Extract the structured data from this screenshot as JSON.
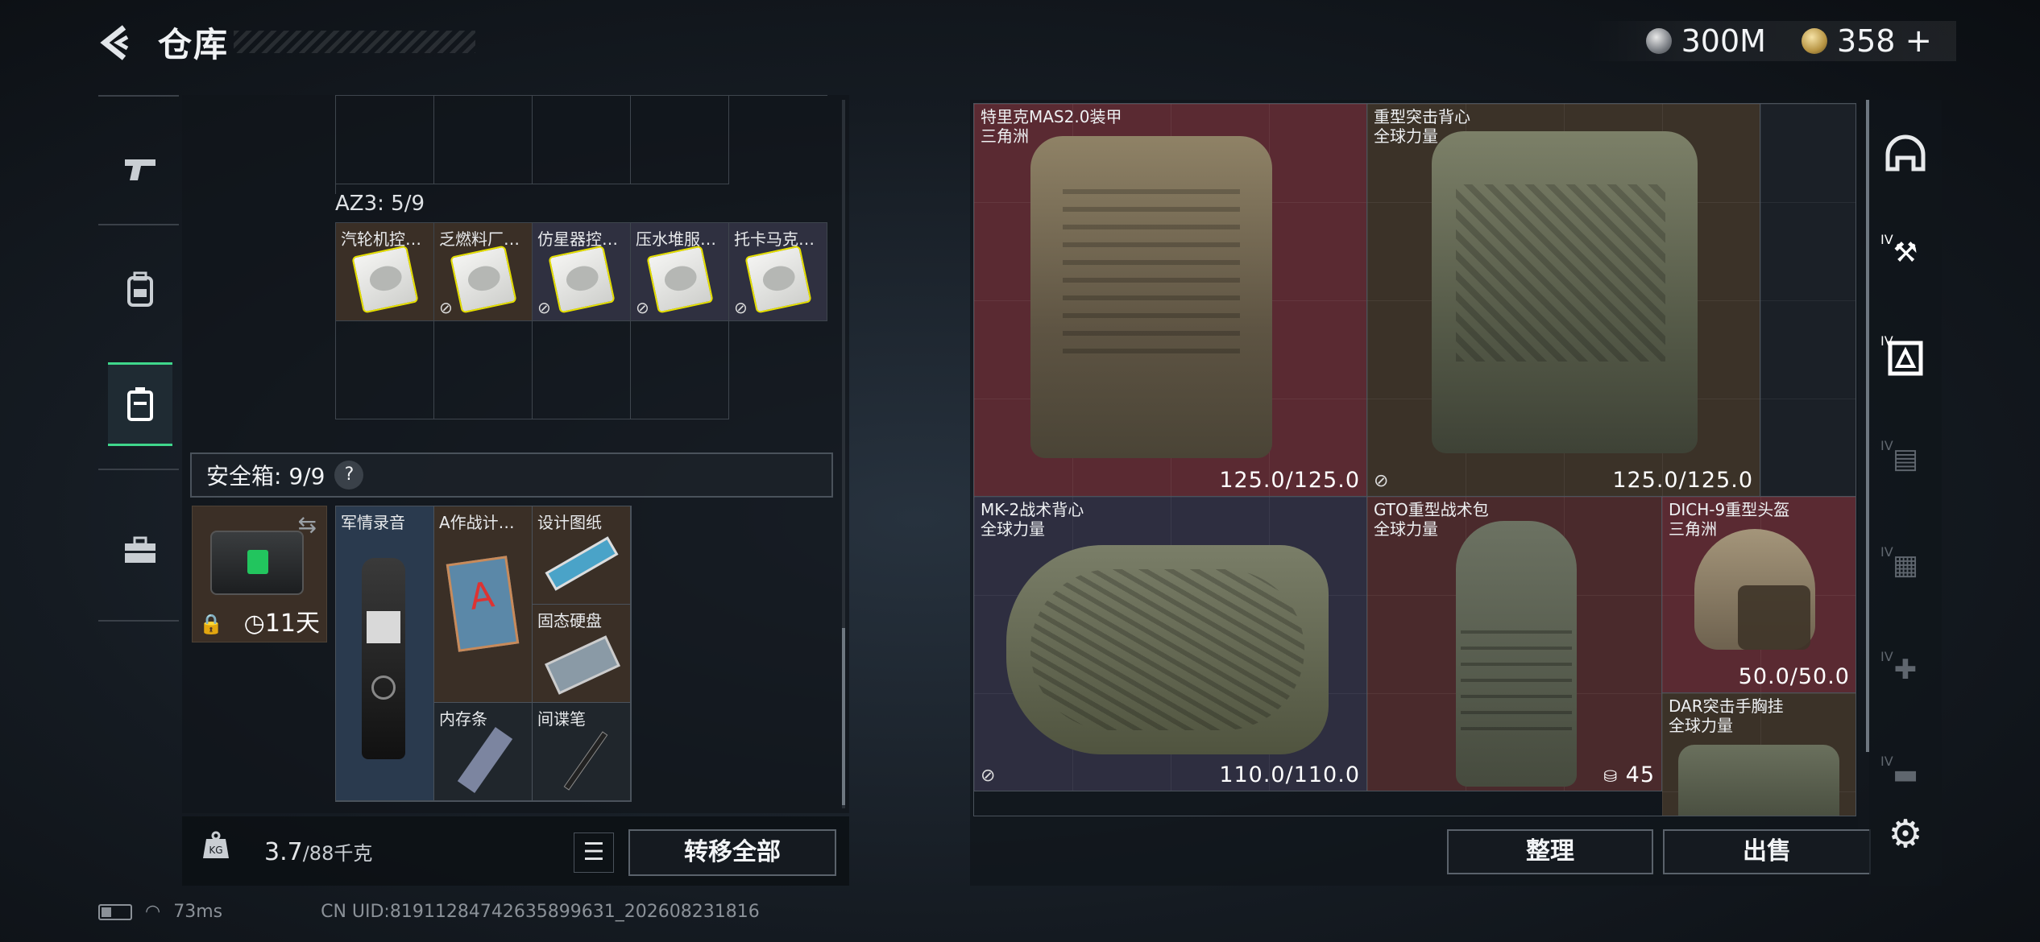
{
  "header": {
    "back_icon": "back-chevron-icon",
    "title": "仓库",
    "currency": [
      {
        "icon": "silver-coin-icon",
        "value": "300M"
      },
      {
        "icon": "gold-coin-icon",
        "value": "358"
      }
    ],
    "plus": "+"
  },
  "left_tabs": [
    {
      "icon": "pistol-icon",
      "active": false
    },
    {
      "icon": "backpack-icon",
      "active": false
    },
    {
      "icon": "vest-container-icon",
      "active": true
    },
    {
      "icon": "toolbox-icon",
      "active": false
    }
  ],
  "az3": {
    "label": "AZ3: 5/9",
    "items": [
      {
        "name": "汽轮机控…",
        "locked": false
      },
      {
        "name": "乏燃料厂…",
        "locked": true
      },
      {
        "name": "仿星器控…",
        "locked": true
      },
      {
        "name": "压水堆服…",
        "locked": true
      },
      {
        "name": "托卡马克…",
        "locked": true
      }
    ]
  },
  "safe_box": {
    "label": "安全箱: 9/9",
    "help": "?",
    "timer": "11天",
    "items": [
      {
        "name": "军情录音"
      },
      {
        "name": "A作战计…"
      },
      {
        "name": "设计图纸"
      },
      {
        "name": "固态硬盘"
      },
      {
        "name": "内存条"
      },
      {
        "name": "间谍笔"
      }
    ]
  },
  "footer": {
    "weight_icon": "KG",
    "weight": "3.7",
    "weight_max": "/88千克",
    "transfer_all": "转移全部"
  },
  "status": {
    "ping": "73ms",
    "uid": "CN UID:81911284742635899631_202608231816"
  },
  "equipment": [
    {
      "name": "特里克MAS2.0装甲",
      "origin": "三角洲",
      "value": "125.0/125.0"
    },
    {
      "name": "重型突击背心",
      "origin": "全球力量",
      "value": "125.0/125.0"
    },
    {
      "name": "MK-2战术背心",
      "origin": "全球力量",
      "value": "110.0/110.0"
    },
    {
      "name": "GTO重型战术包",
      "origin": "全球力量",
      "value": "45"
    },
    {
      "name": "DICH-9重型头盔",
      "origin": "三角洲",
      "value": "50.0/50.0"
    },
    {
      "name": "DAR突击手胸挂",
      "origin": "全球力量",
      "value": ""
    }
  ],
  "actions": {
    "organize": "整理",
    "sell": "出售"
  },
  "right_tabs": [
    {
      "icon": "helmet-tab-icon"
    },
    {
      "icon": "weapon-mod-tab-icon",
      "tier": "IV"
    },
    {
      "icon": "armor-tab-icon",
      "tier": "IV"
    },
    {
      "icon": "gear-tab-icon",
      "tier": "IV"
    },
    {
      "icon": "folder-tab-icon",
      "tier": "IV"
    },
    {
      "icon": "medical-tab-icon",
      "tier": "IV"
    },
    {
      "icon": "ammo-tab-icon",
      "tier": "IV"
    }
  ],
  "settings_icon": "gear-icon"
}
